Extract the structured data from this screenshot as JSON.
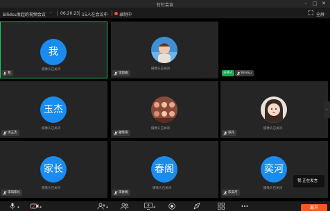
{
  "window": {
    "title": "钉钉会议",
    "minimize_icon": "minimize-icon",
    "maximize_icon": "maximize-icon",
    "close_icon": "close-icon"
  },
  "infobar": {
    "meeting_name": "Bilidsu发起的视频会议",
    "elapsed": "06:20:23",
    "participants": "15人在会议中",
    "recording": "录制中",
    "fullscreen": "全屏",
    "recording_color": "#ff4a3d"
  },
  "camera_off_text": "摄像头已关闭",
  "tiles": [
    {
      "avatar_text": "我",
      "name": "我",
      "camera_off": true,
      "active": true
    },
    {
      "avatar_type": "photo",
      "name": "李超雅",
      "camera_off": true
    },
    {
      "avatar_type": "none",
      "name": "Bilidsu",
      "host_label": "主持人",
      "camera_off": false
    },
    {
      "avatar_text": "玉杰",
      "name": "洪玉杰",
      "camera_off": true
    },
    {
      "avatar_type": "photo",
      "name": "雅晓雨",
      "camera_off": true
    },
    {
      "avatar_type": "photo",
      "name": "张丹",
      "camera_off": true
    },
    {
      "avatar_text": "家长",
      "name": "李琪家长",
      "camera_off": true
    },
    {
      "avatar_text": "春阁",
      "name": "李春阁",
      "camera_off": true
    },
    {
      "avatar_text": "奕河",
      "name": "朱奕河",
      "camera_off": true
    }
  ],
  "speaking_indicator": "我 正在发言",
  "toolbar": {
    "leave_label": "离开",
    "icons": [
      "microphone-icon",
      "camera-icon",
      "add-participant-icon",
      "participants-icon",
      "screen-share-icon",
      "record-icon",
      "interact-icon",
      "more-apps-icon",
      "more-icon"
    ]
  },
  "colors": {
    "accent": "#1a8cf0",
    "host_green": "#17a34a",
    "leave": "#f15a22"
  }
}
